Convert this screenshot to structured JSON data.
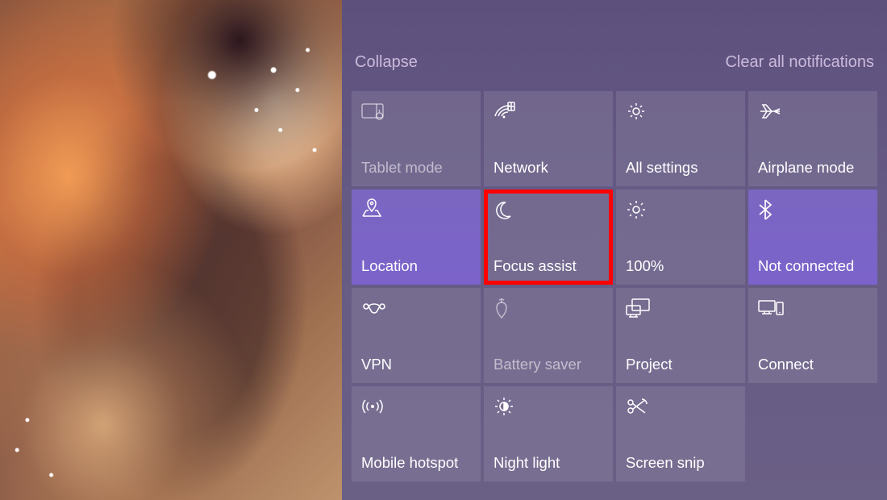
{
  "topbar": {
    "collapse_label": "Collapse",
    "clear_label": "Clear all notifications"
  },
  "tiles": [
    {
      "label": "Tablet mode",
      "icon": "tablet-mode-icon",
      "active": false,
      "disabled": true,
      "highlighted": false
    },
    {
      "label": "Network",
      "icon": "network-icon",
      "active": false,
      "disabled": false,
      "highlighted": false
    },
    {
      "label": "All settings",
      "icon": "settings-gear-icon",
      "active": false,
      "disabled": false,
      "highlighted": false
    },
    {
      "label": "Airplane mode",
      "icon": "airplane-icon",
      "active": false,
      "disabled": false,
      "highlighted": false
    },
    {
      "label": "Location",
      "icon": "location-icon",
      "active": true,
      "disabled": false,
      "highlighted": false
    },
    {
      "label": "Focus assist",
      "icon": "moon-icon",
      "active": false,
      "disabled": false,
      "highlighted": true
    },
    {
      "label": "100%",
      "icon": "brightness-icon",
      "active": false,
      "disabled": false,
      "highlighted": false
    },
    {
      "label": "Not connected",
      "icon": "bluetooth-icon",
      "active": true,
      "disabled": false,
      "highlighted": false
    },
    {
      "label": "VPN",
      "icon": "vpn-icon",
      "active": false,
      "disabled": false,
      "highlighted": false
    },
    {
      "label": "Battery saver",
      "icon": "battery-saver-icon",
      "active": false,
      "disabled": true,
      "highlighted": false
    },
    {
      "label": "Project",
      "icon": "project-icon",
      "active": false,
      "disabled": false,
      "highlighted": false
    },
    {
      "label": "Connect",
      "icon": "connect-icon",
      "active": false,
      "disabled": false,
      "highlighted": false
    },
    {
      "label": "Mobile hotspot",
      "icon": "hotspot-icon",
      "active": false,
      "disabled": false,
      "highlighted": false
    },
    {
      "label": "Night light",
      "icon": "night-light-icon",
      "active": false,
      "disabled": false,
      "highlighted": false
    },
    {
      "label": "Screen snip",
      "icon": "screen-snip-icon",
      "active": false,
      "disabled": false,
      "highlighted": false
    }
  ]
}
